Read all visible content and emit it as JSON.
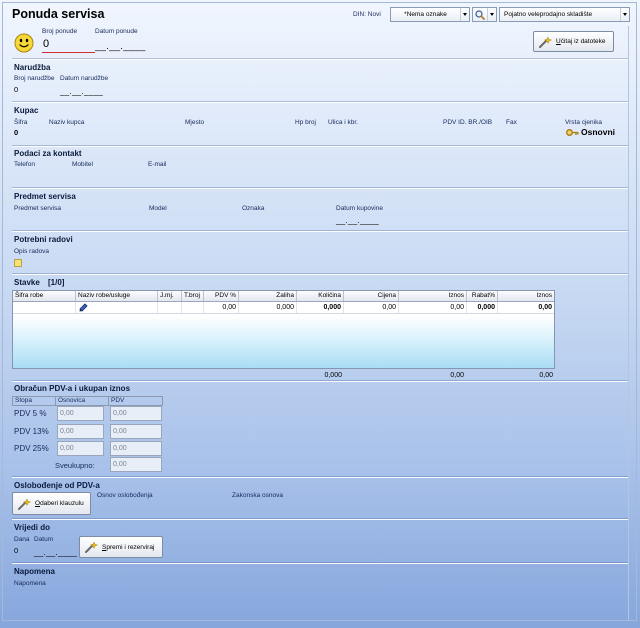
{
  "header": {
    "title": "Ponuda servisa",
    "din": "DIN: Novi",
    "oznaka": "*Nema oznake",
    "skladiste": "Pojatno veleprodajno skladište",
    "load_button": "Učitaj iz datoteke"
  },
  "ponuda": {
    "broj_label": "Broj ponude",
    "datum_label": "Datum ponude",
    "broj_value": "0",
    "datum_value": "__.__.____"
  },
  "narudzba": {
    "title": "Narudžba",
    "broj_label": "Broj narudžbe",
    "datum_label": "Datum narudžbe",
    "broj_value": "0",
    "datum_value": "__.__.____"
  },
  "kupac": {
    "title": "Kupac",
    "labels": [
      "Šifra",
      "Naziv kupca",
      "Mjesto",
      "Hp broj",
      "Ulica i kbr.",
      "PDV ID. BR./OIB",
      "Fax",
      "Vrsta cjenika"
    ],
    "sifra_value": "0",
    "cjenik_value": "Osnovni"
  },
  "kontakt": {
    "title": "Podaci za kontakt",
    "labels": [
      "Telefon",
      "Mobitel",
      "E-mail"
    ]
  },
  "predmet": {
    "title": "Predmet servisa",
    "labels": [
      "Predmet servisa",
      "Model",
      "Oznaka",
      "Datum kupovine"
    ],
    "datum_kupovine": "__.__.____"
  },
  "radovi": {
    "title": "Potrebni radovi",
    "opis_label": "Opis radova"
  },
  "stavke": {
    "title": "Stavke",
    "counter": "[1/0]",
    "columns": [
      "Šifra robe",
      "Naziv robe/usluge",
      "J.mj.",
      "T.broj",
      "PDV %",
      "Zaliha",
      "Količina",
      "Cijena",
      "Iznos",
      "Rabat%",
      "Iznos"
    ],
    "rows": [
      {
        "pdv": "0,00",
        "zaliha": "0,000",
        "kolicina": "0,000",
        "cijena": "0,00",
        "iznos": "0,00",
        "rabat": "0,000",
        "iznos_ukupno": "0,00"
      }
    ],
    "totals": {
      "kolicina": "0,000",
      "iznos": "0,00",
      "iznos_ukupno": "0,00"
    }
  },
  "obracun": {
    "title": "Obračun PDV-a i ukupan iznos",
    "columns": [
      "Stopa",
      "Osnovica",
      "PDV"
    ],
    "rows": [
      {
        "stopa": "PDV 5 %",
        "osnovica": "0,00",
        "pdv": "0,00"
      },
      {
        "stopa": "PDV 13%",
        "osnovica": "0,00",
        "pdv": "0,00"
      },
      {
        "stopa": "PDV 25%",
        "osnovica": "0,00",
        "pdv": "0,00"
      }
    ],
    "sveukupno_label": "Sveukupno:",
    "sveukupno_value": "0,00"
  },
  "oslobodenje": {
    "title": "Oslobođenje od PDV-a",
    "button": "Odaberi klauzulu",
    "osnov_label": "Osnov oslobođenja",
    "zakonska_label": "Zakonska osnova"
  },
  "vrijedi": {
    "title": "Vrijedi do",
    "dana_label": "Dana",
    "datum_label": "Datum",
    "dana_value": "0",
    "datum_value": "__.__.____",
    "button": "Spremi i rezerviraj"
  },
  "napomena": {
    "title": "Napomena",
    "label": "Napomena"
  },
  "icons": {
    "status": "smiley-icon",
    "search": "search-icon",
    "buttons": "wand-icon",
    "price_list": "key-icon",
    "row_edit": "pencil-icon",
    "notes": "note-icon",
    "dropdown": "chevron-down-icon"
  },
  "colors": {
    "background_top": "#f1f6fe",
    "background_bottom": "#86a6dc",
    "active_underline": "#d03030",
    "grid_bottom": "#a9ddf4"
  }
}
